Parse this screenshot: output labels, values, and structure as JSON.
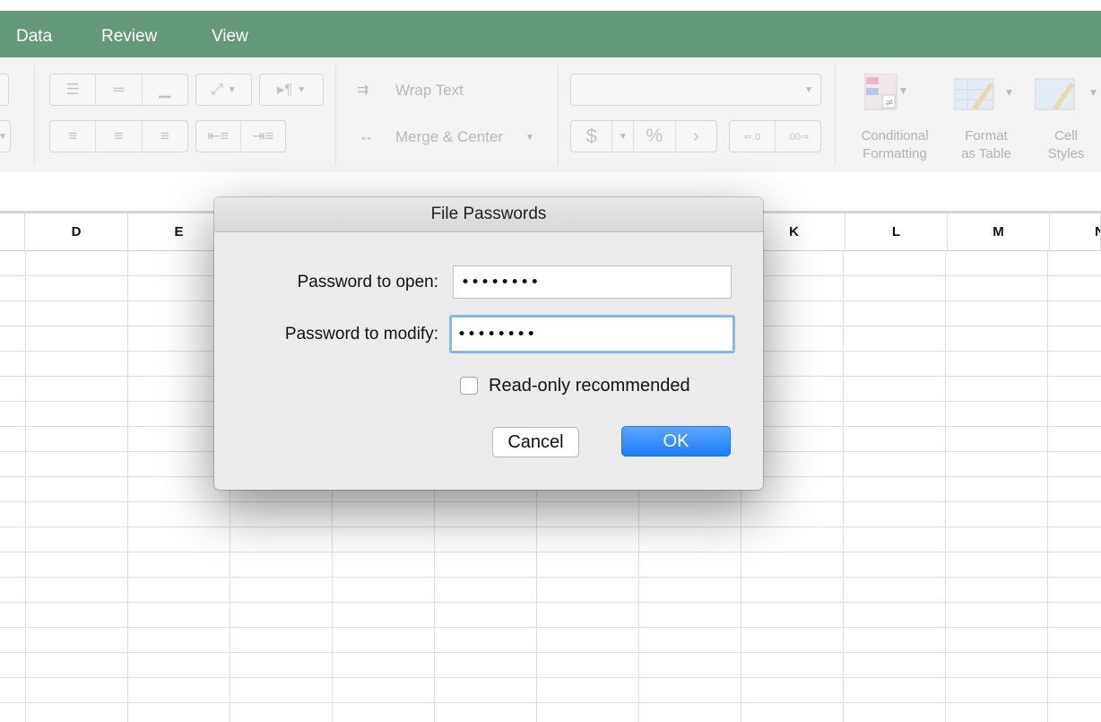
{
  "tabs": [
    {
      "label": "Data"
    },
    {
      "label": "Review"
    },
    {
      "label": "View"
    }
  ],
  "ribbon": {
    "wrap_text": "Wrap Text",
    "merge_center": "Merge & Center",
    "number_format_value": "",
    "currency_symbol": "$",
    "percent_symbol": "%",
    "conditional_formatting": [
      "Conditional",
      "Formatting"
    ],
    "format_as_table": [
      "Format",
      "as Table"
    ],
    "cell_styles": [
      "Cell",
      "Styles"
    ]
  },
  "columns": [
    "D",
    "E",
    "K",
    "L",
    "M",
    "N"
  ],
  "dialog": {
    "title": "File Passwords",
    "open_label": "Password to open:",
    "open_value": "••••••••",
    "modify_label": "Password to modify:",
    "modify_value": "••••••••",
    "readonly_label": "Read-only recommended",
    "readonly_checked": false,
    "cancel_label": "Cancel",
    "ok_label": "OK"
  },
  "colors": {
    "tabbar": "#64987a",
    "ok_button": "#1d7dfa",
    "focus_ring": "#8ab6ee"
  }
}
